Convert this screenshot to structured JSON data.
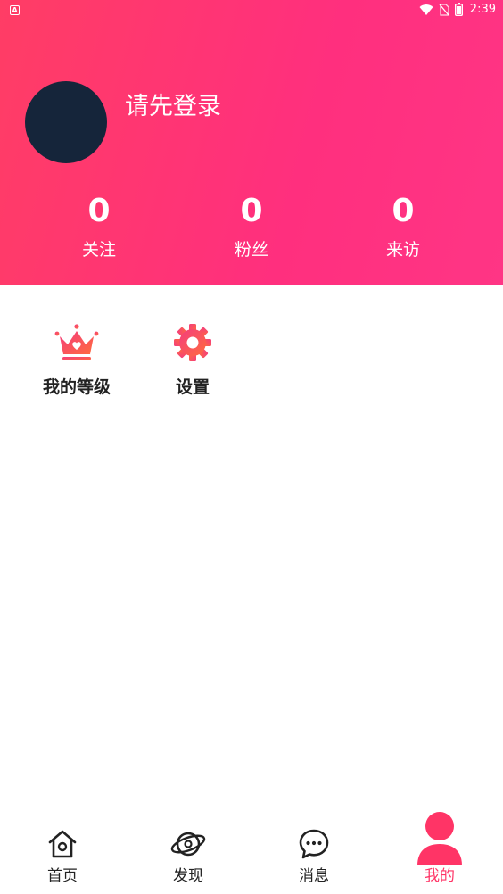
{
  "status_bar": {
    "time": "2:39",
    "left_icon_letter": "A",
    "icons": [
      "wifi-icon",
      "no-sim-icon",
      "battery-icon"
    ]
  },
  "profile": {
    "login_prompt": "请先登录"
  },
  "stats": [
    {
      "value": "0",
      "label": "关注"
    },
    {
      "value": "0",
      "label": "粉丝"
    },
    {
      "value": "0",
      "label": "来访"
    }
  ],
  "features": [
    {
      "label": "我的等级",
      "icon": "crown-icon"
    },
    {
      "label": "设置",
      "icon": "gear-icon"
    }
  ],
  "bottom_nav": {
    "active_index": 3,
    "items": [
      {
        "label": "首页",
        "icon": "home-icon"
      },
      {
        "label": "发现",
        "icon": "planet-icon"
      },
      {
        "label": "消息",
        "icon": "chat-bubble-icon"
      },
      {
        "label": "我的",
        "icon": "person-icon"
      }
    ]
  },
  "colors": {
    "gradient_start": "#ff3d65",
    "gradient_end": "#ff3585",
    "accent": "#ff3466",
    "avatar_bg": "#15253a",
    "text_dark": "#222222"
  }
}
